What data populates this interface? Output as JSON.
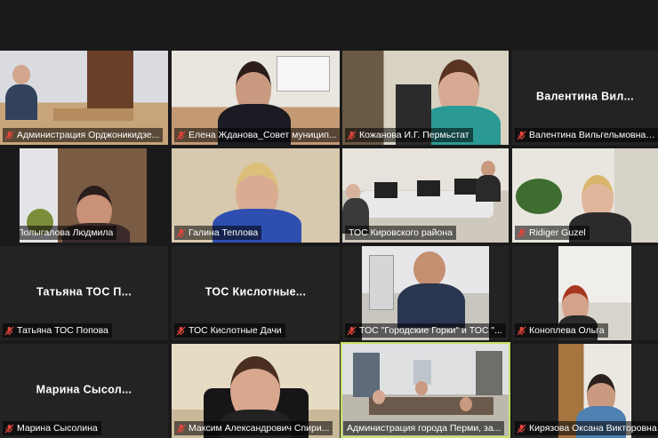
{
  "tiles": [
    {
      "label": "Администрация Орджоникидзе..."
    },
    {
      "label": "Елена Жданова_Совет муницип..."
    },
    {
      "label": "Кожанова И.Г. Пермьстат"
    },
    {
      "label": "Валентина Вильгельмовна ТОС",
      "center": "Валентина Вил..."
    },
    {
      "label": "Полыгалова Людмила"
    },
    {
      "label": "Галина Теплова"
    },
    {
      "label": "ТОС Кировского района"
    },
    {
      "label": "Ridiger Guzel"
    },
    {
      "label": "Татьяна ТОС Попова",
      "center": "Татьяна ТОС П..."
    },
    {
      "label": "ТОС Кислотные Дачи",
      "center": "ТОС Кислотные..."
    },
    {
      "label": "ТОС \"Городские Горки\" и ТОС \"..."
    },
    {
      "label": "Коноплева Ольга"
    },
    {
      "label": "Марина Сысолина",
      "center": "Марина Сысол..."
    },
    {
      "label": "Максим Александрович Спири..."
    },
    {
      "label": "Администрация города Перми, за..."
    },
    {
      "label": "Кирязова Оксана Викторовна"
    }
  ],
  "colors": {
    "background": "#1a1a1a",
    "tile": "#232323",
    "active_border": "#c8e26a",
    "muted_mic": "#e0453c"
  }
}
